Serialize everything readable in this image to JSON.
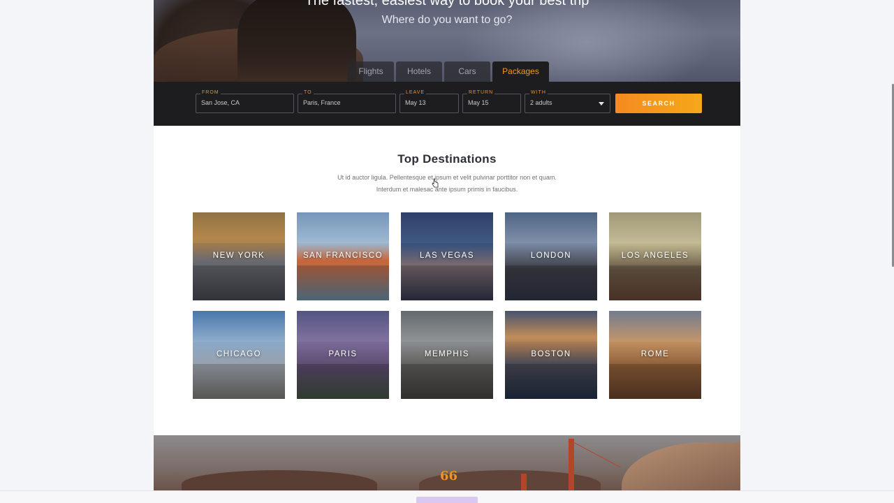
{
  "hero": {
    "tagline": "The fastest, easiest way to book your best trip",
    "subtitle": "Where do you want to go?"
  },
  "tabs": [
    {
      "label": "Flights",
      "active": false
    },
    {
      "label": "Hotels",
      "active": false
    },
    {
      "label": "Cars",
      "active": false
    },
    {
      "label": "Packages",
      "active": true
    }
  ],
  "search": {
    "from": {
      "label": "FROM",
      "value": "San Jose, CA"
    },
    "to": {
      "label": "TO",
      "value": "Paris, France"
    },
    "leave": {
      "label": "LEAVE",
      "value": "May 13"
    },
    "return": {
      "label": "RETURN",
      "value": "May 15"
    },
    "with": {
      "label": "WITH",
      "value": "2 adults"
    },
    "button": "SEARCH"
  },
  "destinations": {
    "title": "Top Destinations",
    "desc_line1": "Ut id auctor ligula. Pellentesque et ipsum et velit pulvinar porttitor non et quam.",
    "desc_line2": "Interdum et malesac ante ipsum primis in faucibus.",
    "items": [
      "NEW YORK",
      "SAN FRANCISCO",
      "LAS VEGAS",
      "LONDON",
      "LOS ANGELES",
      "CHICAGO",
      "PARIS",
      "MEMPHIS",
      "BOSTON",
      "ROME"
    ]
  },
  "testimonial": {
    "quote_mark": "66"
  },
  "colors": {
    "accent": "#f09a1e",
    "dark_bar": "#1d1d20"
  }
}
